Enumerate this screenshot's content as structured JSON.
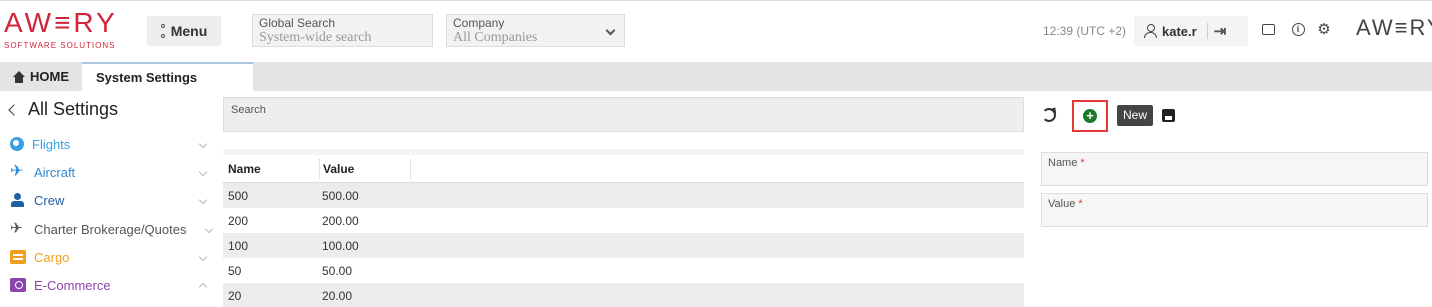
{
  "header": {
    "logo_word": "AW≡RY",
    "logo_sub": "SOFTWARE SOLUTIONS",
    "menu_label": "Menu",
    "global_search": {
      "label": "Global Search",
      "placeholder": "System-wide search"
    },
    "company": {
      "label": "Company",
      "value": "All Companies"
    },
    "time": "12:39 (UTC +2)",
    "username": "kate.r",
    "logo_small": "AW≡RY"
  },
  "tabs": [
    {
      "label": "HOME"
    },
    {
      "label": "System Settings"
    }
  ],
  "sidebar": {
    "back_label": "All Settings",
    "items": [
      {
        "label": "Flights",
        "color": "#3ba0e0",
        "icon": "flights-icon"
      },
      {
        "label": "Aircraft",
        "color": "#2d8ad6",
        "icon": "aircraft-icon"
      },
      {
        "label": "Crew",
        "color": "#1f5fa8",
        "icon": "crew-icon"
      },
      {
        "label": "Charter Brokerage/Quotes",
        "color": "#555555",
        "icon": "charter-icon"
      },
      {
        "label": "Cargo",
        "color": "#f0a020",
        "icon": "cargo-icon"
      },
      {
        "label": "E-Commerce",
        "color": "#8e44ad",
        "icon": "ecommerce-icon"
      }
    ]
  },
  "search": {
    "label": "Search"
  },
  "table": {
    "columns": [
      "Name",
      "Value"
    ],
    "rows": [
      {
        "name": "500",
        "value": "500.00"
      },
      {
        "name": "200",
        "value": "200.00"
      },
      {
        "name": "100",
        "value": "100.00"
      },
      {
        "name": "50",
        "value": "50.00"
      },
      {
        "name": "20",
        "value": "20.00"
      }
    ]
  },
  "toolbar": {
    "new_tooltip": "New"
  },
  "form": {
    "name_label": "Name",
    "value_label": "Value",
    "required_mark": "*"
  }
}
